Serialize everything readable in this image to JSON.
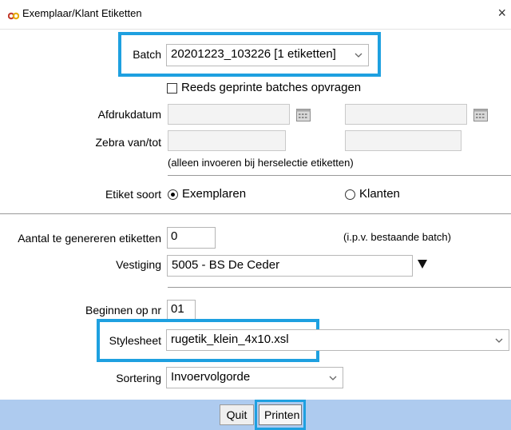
{
  "window": {
    "title": "Exemplaar/Klant Etiketten",
    "close_symbol": "×",
    "icon": "app-logo-icon"
  },
  "batch": {
    "label": "Batch",
    "value": "20201223_103226 [1 etiketten]"
  },
  "reprinted": {
    "label": "Reeds geprinte batches opvragen",
    "checked": false
  },
  "print_date": {
    "label": "Afdrukdatum",
    "from": "",
    "to": ""
  },
  "zebra": {
    "label": "Zebra van/tot",
    "from": "",
    "to": ""
  },
  "hint": "(alleen invoeren bij herselectie etiketten)",
  "label_type": {
    "label": "Etiket soort",
    "options": [
      "Exemplaren",
      "Klanten"
    ],
    "selected": "Exemplaren"
  },
  "count": {
    "label": "Aantal te genereren etiketten",
    "value": "0",
    "note": "(i.p.v. bestaande batch)"
  },
  "branch": {
    "label": "Vestiging",
    "value": "5005 - BS De Ceder"
  },
  "start_nr": {
    "label": "Beginnen op nr",
    "value": "01"
  },
  "stylesheet": {
    "label": "Stylesheet",
    "value": "rugetik_klein_4x10.xsl"
  },
  "sorting": {
    "label": "Sortering",
    "value": "Invoervolgorde"
  },
  "buttons": {
    "quit": "Quit",
    "print": "Printen"
  },
  "colors": {
    "highlight": "#1ea0e0",
    "bottom_bar": "#aecbef"
  }
}
